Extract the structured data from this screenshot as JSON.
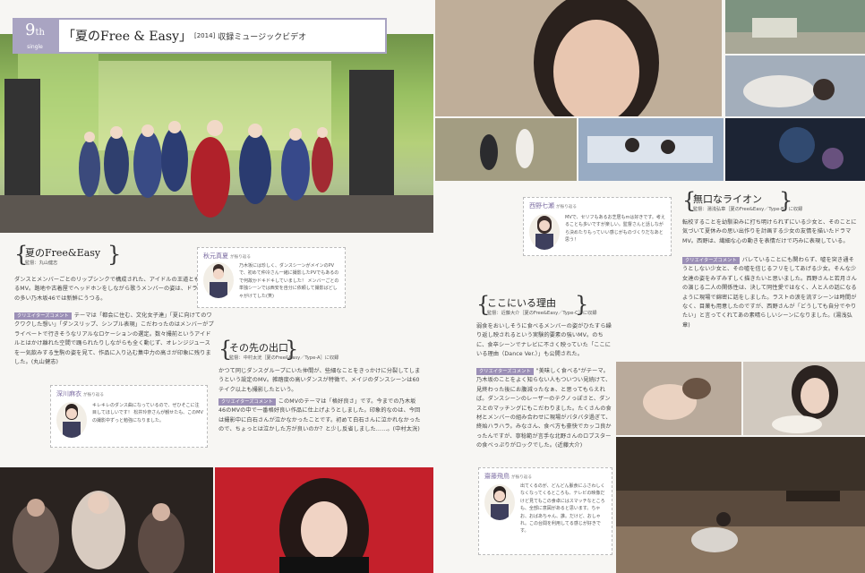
{
  "header": {
    "number": "9",
    "suffix": "th",
    "kind": "single",
    "title_main": "「夏のFree & Easy」",
    "title_year": "[2014]",
    "title_sub": "収録ミュージックビデオ"
  },
  "left_sections": {
    "section1": {
      "title": "夏のFree&Easy",
      "credit": "監督：丸山健志",
      "text1": "ダンスとメンバーごとのリップシンクで構成された、アイドルの王道とも言えるMV。路地や古着屋でヘッドホンをしながら歌うメンバーの姿は、ドラマMVの多い乃木坂46では新鮮にうつる。",
      "tag": "クリエイターズコメント",
      "text2": "テーマは「都会に住む、文化女子達」「夏に向けてのワクワクした想い」「ダンスリップ、シンプル表現」こだわったのはメンバーがプライベートで行きそうなリアルなロケーションの選定。数々撮前というアイドルとはかけ離れた空間で踊られたりしながらも全く動じず、オレンジジュースを一気飲みする生駒の姿を見て、作品に入り込む集中力の高さが印象に残りました。(丸山健志)"
    },
    "section2": {
      "title": "その先の出口",
      "credit": "監督：中村太洸［夏のFree&Easy／Type-A］に収録",
      "text1": "かつて同じダンスグループにいた仲間が、些細なことをきっかけに分裂してしまうという設定のMV。雑踏度の高いダンスが特徴で、メイジのダンスシーンは60テイク以上も撮影したという。",
      "tag": "クリエイターズコメント",
      "text2": "このMVのテーマは「格好良さ」です。今までの乃木坂46のMVの中で一番格好良い作品に仕上げようとしました。印象的なのは、今回は撮影中に白石さんが泣かなかったことです。初めて白石さんに泣かれなかったので、ちょっとは泣かした方が良いのか？と少し反省しました……。(中村太洸)"
    },
    "card_akimoto": {
      "name": "秋元真夏",
      "role": "が振り返る",
      "msg": "乃木坂には珍しく、ダンスシーンがメインのPVで、初めて仲冷さん一緒に撮影したPVでもあるので何故かドキドキしていました！ メンバーごとの単独シーンでは西安を自分に依頼して撮影ばどしゃがけてした(笑)"
    },
    "card_fukagawa": {
      "name": "深川麻衣",
      "role": "が振り返る",
      "msg": "キレキレのダンス曲になっているので、ぜひそこに注目してほしいです！ 松井玲奈さんが観せたも、このMVの撮影中ずっと勉強になりました。"
    }
  },
  "right_sections": {
    "section3": {
      "title": "無口なライオン",
      "credit": "監督：湯浅弘章［夏のFree&Easy／Type-B］に収録",
      "text1": "転校することを幼馴染みに打ち明けられずにいる少女と、そのことに気づいて夏休みの思い出作りを計画する少女の友情を描いたドラマMV。西野は、繊細な心の動きを表情だけで巧みに表現している。",
      "tag": "クリエイターズコメント",
      "text2": "バレていることにも関わらず、嘘を突き通そうとしない少女と、その嘘を信じるフリをしてあげる少女。そんな少女達の姿をみずみずしく描きたいと思いました。西野さんと若月さんの演じる二人の関係性は、決して同性愛ではなく、人と人の話になるように現場で綿密に話をしました。ラストの涙を流すシーンは時間がなく、目薬も用意したのですが、西野さんが「どうしても自分でやりたい」と言ってくれてあの素晴らしいシーンになりました。(湯浅弘章)"
    },
    "section4": {
      "title": "ここにいる理由",
      "credit": "監督：近藤大介［夏のFree&Easy／Type-C］に収録",
      "text1": "弱食をおいしそうに食べるメンバーの姿がひたすら繰り返し映されるという実験的要素の強いMV。のちに、食卒シーンでナレビに不さく映っていた「ここにいる理由（Dance Ver.）」も公開された。",
      "tag": "クリエイターズコメント",
      "text2": "\"美味しく食べる\"がテーマ。乃木坂のことをよく知らない人もついつい見続けて、見終わった後にお腹減ったなぁ、と思ってもらえれば。ダンスシーンのレーザーのテクノっぽさと、ダンスとのマッチングにもこだわりました。たくさんの食材とメンバーの組み合わせに現場がバタバタ過ぎて、終始ハラハラ。みなさん、食べ方も豪快でカッコ良かったんですが、寧稔範が言手な北野さんのロブスターの食べっぷりがロックでした。(近藤大介)"
    },
    "card_nishino": {
      "name": "西野七瀬",
      "role": "が振り返る",
      "msg": "MVで、セリフもあるお芝居もmは好きです。考えることも多いですが楽しい。監督さんと話しながら決めたりもっていい感じがものづくりだなあと思う！"
    },
    "card_saito": {
      "name": "齋藤飛鳥",
      "role": "が振り返る",
      "msg": "出てくるのが、どんどん脈食にふさわしくなくなってくるところも、テレビの映像だけど見てもこの食卓にはスマッチなところも、全部に意図があると思います。ちゃお、おばあちゃん、誰。だけど、おしゃれ。この台間を利用してる感じが好きです。"
    }
  },
  "colors": {
    "accent": "#9b8fb6",
    "header_bg": "#a9a4c2",
    "name": "#7a6aa0",
    "page_bg": "#f7f6f3"
  }
}
